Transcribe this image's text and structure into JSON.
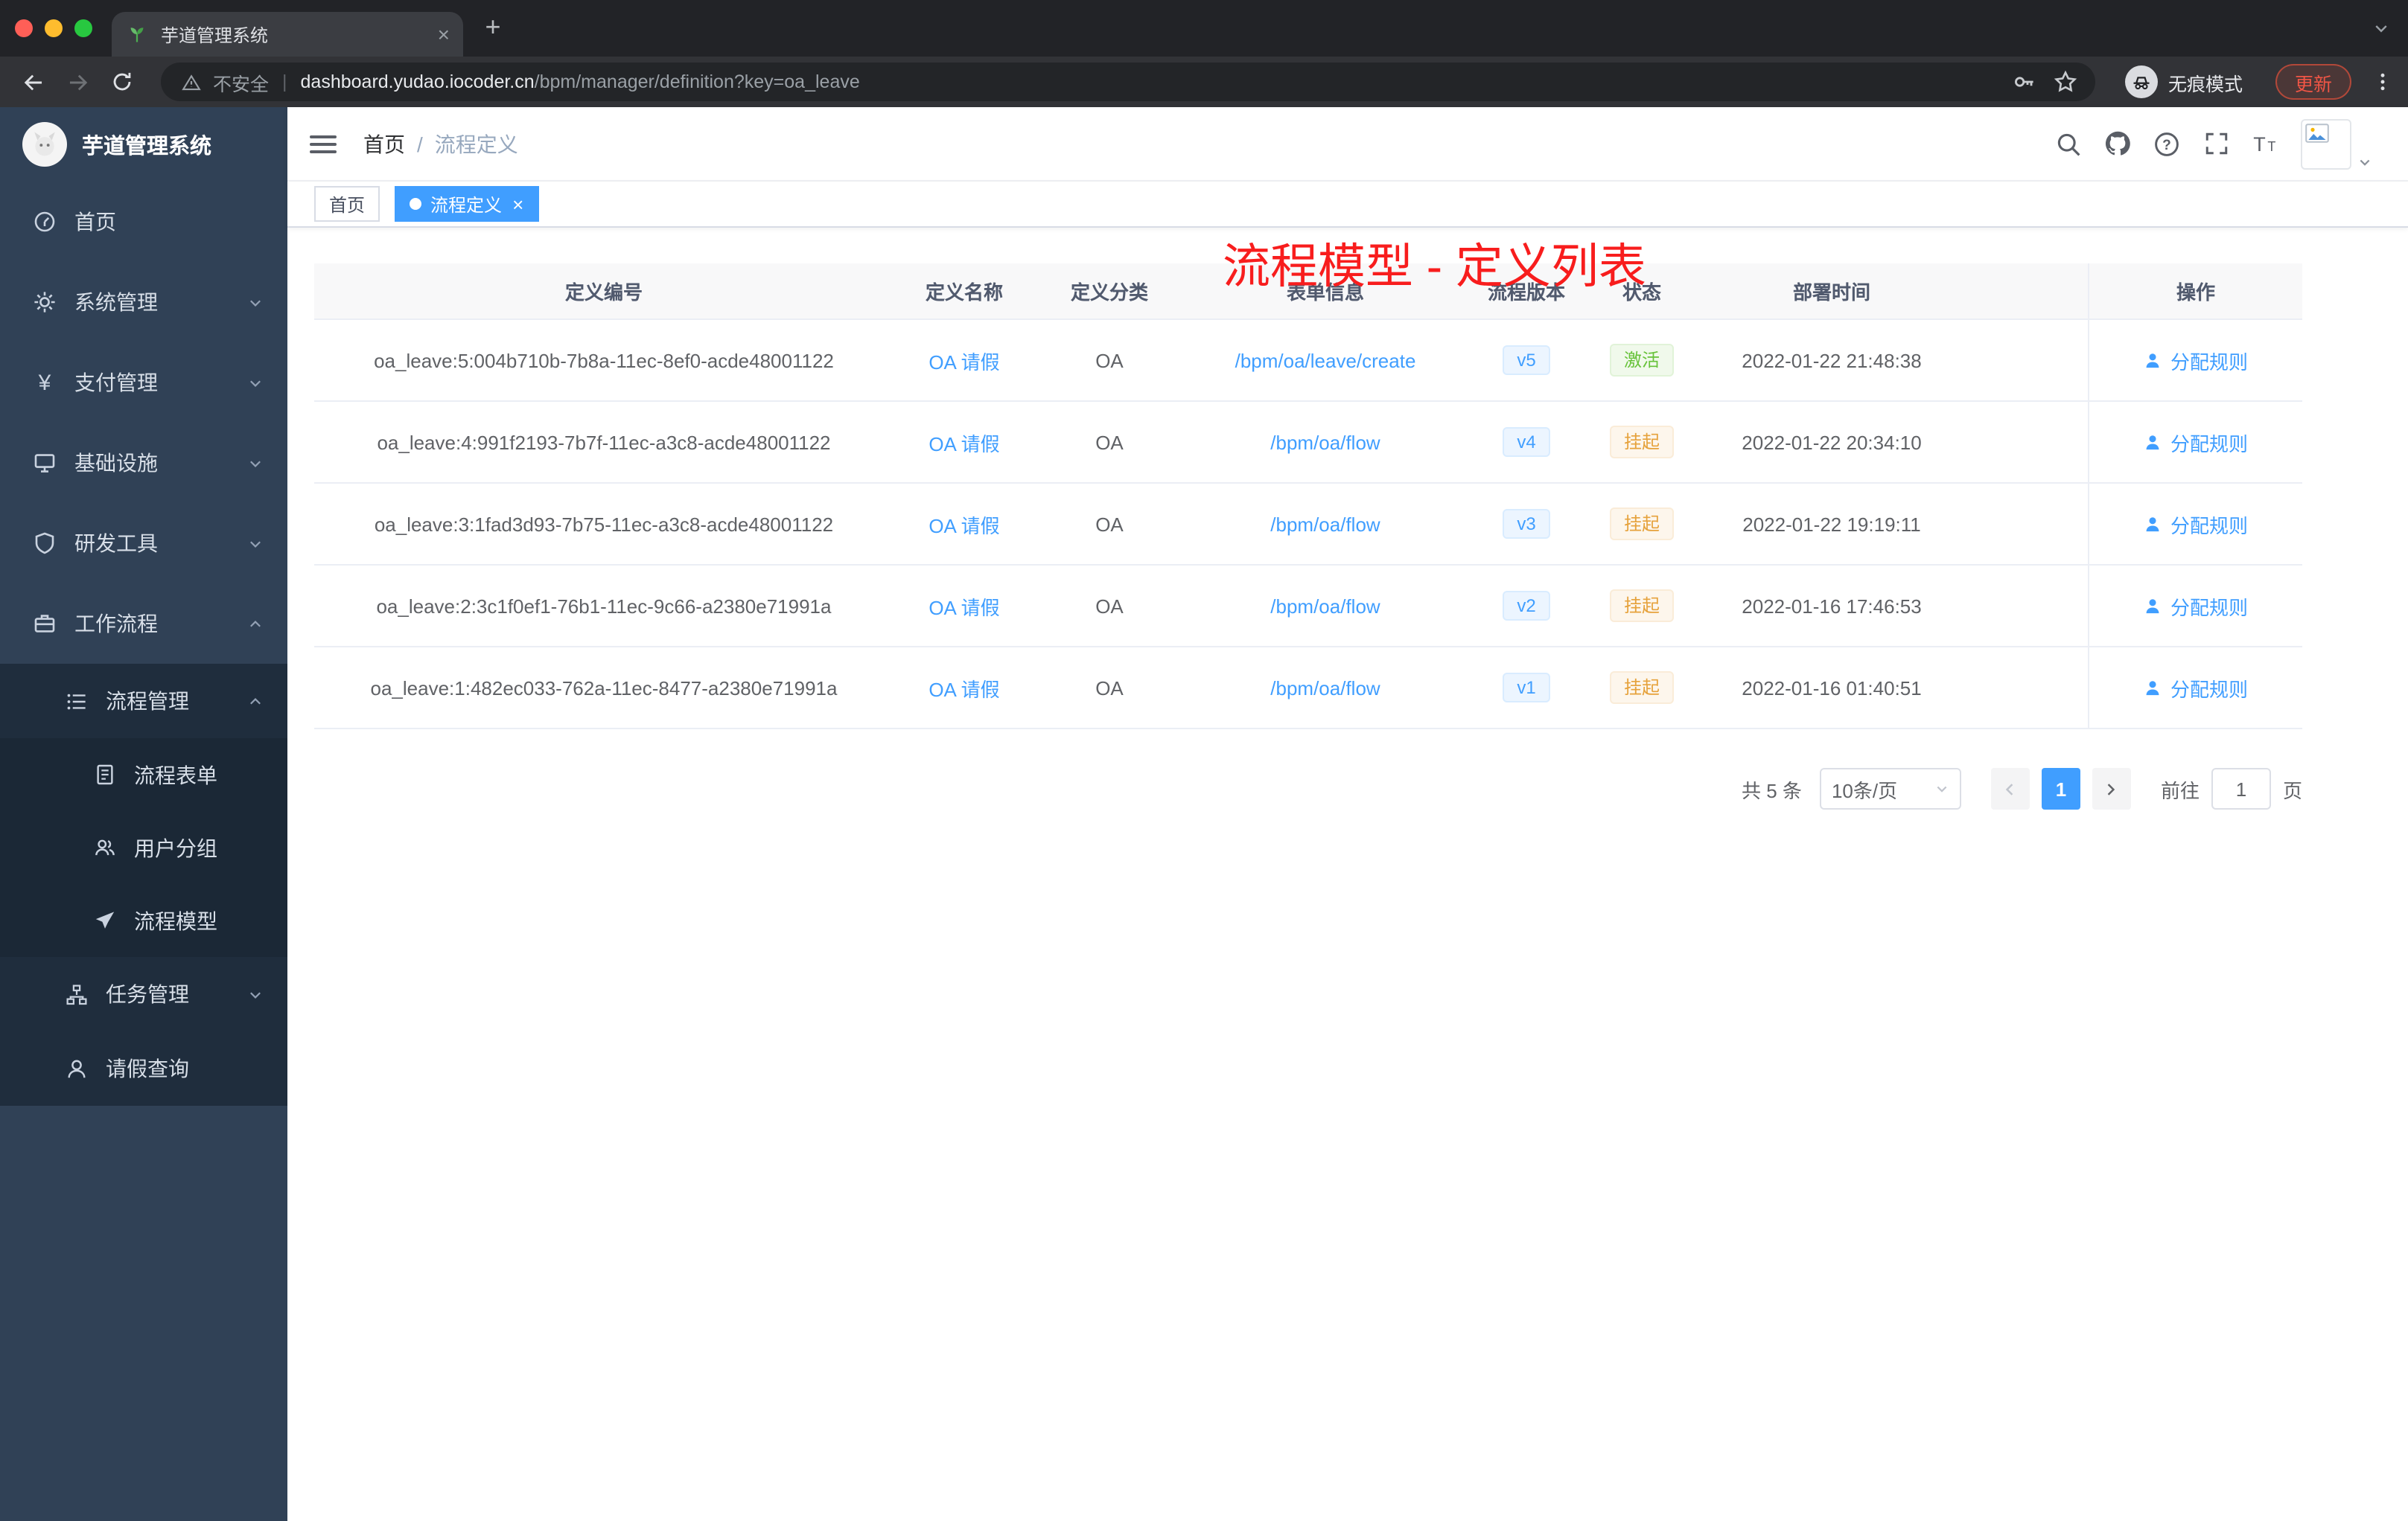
{
  "browser": {
    "tab": {
      "title": "芋道管理系统"
    },
    "toolbar": {
      "security_label": "不安全",
      "url_domain": "dashboard.yudao.iocoder.cn",
      "url_path": "/bpm/manager/definition?key=oa_leave",
      "incognito_label": "无痕模式",
      "update_label": "更新"
    }
  },
  "sidebar": {
    "title": "芋道管理系统",
    "items": [
      {
        "label": "首页"
      },
      {
        "label": "系统管理"
      },
      {
        "label": "支付管理"
      },
      {
        "label": "基础设施"
      },
      {
        "label": "研发工具"
      },
      {
        "label": "工作流程"
      },
      {
        "label": "流程管理"
      },
      {
        "label": "流程表单"
      },
      {
        "label": "用户分组"
      },
      {
        "label": "流程模型"
      },
      {
        "label": "任务管理"
      },
      {
        "label": "请假查询"
      }
    ]
  },
  "header": {
    "breadcrumb": {
      "home": "首页",
      "sep": "/",
      "current": "流程定义"
    },
    "annotation": "流程模型 - 定义列表"
  },
  "tags": {
    "home": "首页",
    "active": "流程定义"
  },
  "table": {
    "columns": [
      "定义编号",
      "定义名称",
      "定义分类",
      "表单信息",
      "流程版本",
      "状态",
      "部署时间",
      "操作"
    ],
    "action_label": "分配规则",
    "rows": [
      {
        "id": "oa_leave:5:004b710b-7b8a-11ec-8ef0-acde48001122",
        "name": "OA 请假",
        "category": "OA",
        "form": "/bpm/oa/leave/create",
        "version": "v5",
        "status": "激活",
        "time": "2022-01-22 21:48:38"
      },
      {
        "id": "oa_leave:4:991f2193-7b7f-11ec-a3c8-acde48001122",
        "name": "OA 请假",
        "category": "OA",
        "form": "/bpm/oa/flow",
        "version": "v4",
        "status": "挂起",
        "time": "2022-01-22 20:34:10"
      },
      {
        "id": "oa_leave:3:1fad3d93-7b75-11ec-a3c8-acde48001122",
        "name": "OA 请假",
        "category": "OA",
        "form": "/bpm/oa/flow",
        "version": "v3",
        "status": "挂起",
        "time": "2022-01-22 19:19:11"
      },
      {
        "id": "oa_leave:2:3c1f0ef1-76b1-11ec-9c66-a2380e71991a",
        "name": "OA 请假",
        "category": "OA",
        "form": "/bpm/oa/flow",
        "version": "v2",
        "status": "挂起",
        "time": "2022-01-16 17:46:53"
      },
      {
        "id": "oa_leave:1:482ec033-762a-11ec-8477-a2380e71991a",
        "name": "OA 请假",
        "category": "OA",
        "form": "/bpm/oa/flow",
        "version": "v1",
        "status": "挂起",
        "time": "2022-01-16 01:40:51"
      }
    ]
  },
  "pagination": {
    "total": "共 5 条",
    "page_size": "10条/页",
    "current_page": "1",
    "goto_label": "前往",
    "goto_value": "1",
    "page_label": "页"
  },
  "colors": {
    "accent": "#409eff",
    "status_active": "#67c23a",
    "status_suspended": "#e6a23c",
    "annotation_red": "#f81d1d",
    "sidebar_bg": "#304156",
    "submenu_bg": "#1f2d3d"
  }
}
